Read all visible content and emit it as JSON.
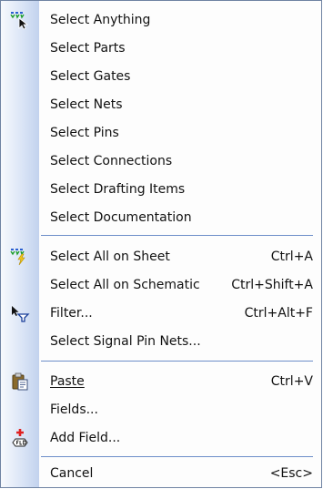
{
  "menu": {
    "items": [
      {
        "label": "Select Anything",
        "shortcut": "",
        "icon": "select-anything-icon"
      },
      {
        "label": "Select Parts",
        "shortcut": ""
      },
      {
        "label": "Select Gates",
        "shortcut": ""
      },
      {
        "label": "Select Nets",
        "shortcut": ""
      },
      {
        "label": "Select Pins",
        "shortcut": ""
      },
      {
        "label": "Select Connections",
        "shortcut": ""
      },
      {
        "label": "Select Drafting Items",
        "shortcut": ""
      },
      {
        "label": "Select Documentation",
        "shortcut": ""
      },
      {
        "label": "Select All on Sheet",
        "shortcut": "Ctrl+A",
        "icon": "select-all-icon"
      },
      {
        "label": "Select All on Schematic",
        "shortcut": "Ctrl+Shift+A"
      },
      {
        "label": "Filter...",
        "shortcut": "Ctrl+Alt+F",
        "icon": "filter-icon"
      },
      {
        "label": "Select Signal Pin Nets...",
        "shortcut": ""
      },
      {
        "label": "Paste",
        "shortcut": "Ctrl+V",
        "icon": "paste-icon",
        "mnemonic": "P"
      },
      {
        "label": "Fields...",
        "shortcut": ""
      },
      {
        "label": "Add Field...",
        "shortcut": "",
        "icon": "add-field-icon"
      },
      {
        "label": "Cancel",
        "shortcut": "<Esc>"
      }
    ]
  },
  "colors": {
    "border": "#6f83a3",
    "gutter_light": "#f7f9fd",
    "gutter_dark": "#c2d2ee",
    "separator": "#6d8ec9",
    "text": "#111111"
  }
}
